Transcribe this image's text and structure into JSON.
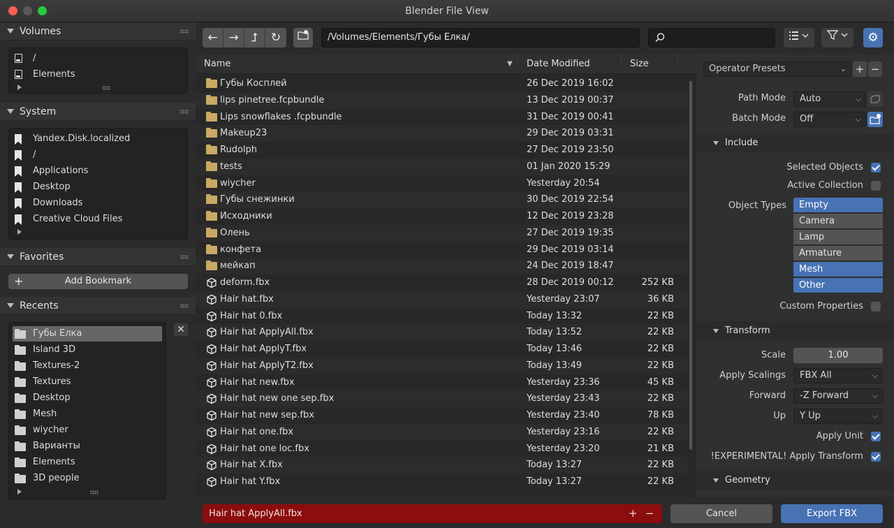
{
  "window": {
    "title": "Blender File View"
  },
  "sidebar": {
    "volumes": {
      "title": "Volumes",
      "items": [
        {
          "label": "/"
        },
        {
          "label": "Elements"
        }
      ]
    },
    "system": {
      "title": "System",
      "items": [
        {
          "label": "Yandex.Disk.localized"
        },
        {
          "label": "/"
        },
        {
          "label": "Applications"
        },
        {
          "label": "Desktop"
        },
        {
          "label": "Downloads"
        },
        {
          "label": "Creative Cloud Files"
        }
      ]
    },
    "favorites": {
      "title": "Favorites",
      "add_label": "Add Bookmark"
    },
    "recents": {
      "title": "Recents",
      "items": [
        {
          "label": "Губы Елка"
        },
        {
          "label": "Island 3D"
        },
        {
          "label": "Textures-2"
        },
        {
          "label": "Textures"
        },
        {
          "label": "Desktop"
        },
        {
          "label": "Mesh"
        },
        {
          "label": "wiycher"
        },
        {
          "label": "Варианты"
        },
        {
          "label": "Elements"
        },
        {
          "label": "3D people"
        }
      ]
    }
  },
  "toolbar": {
    "path": "/Volumes/Elements/Губы Елка/"
  },
  "file_list": {
    "columns": {
      "name": "Name",
      "date": "Date Modified",
      "size": "Size"
    },
    "rows": [
      {
        "name": " Губы Косплей",
        "date": "26 Dec 2019 16:02",
        "size": "",
        "type": "folder"
      },
      {
        "name": "lips pinetree.fcpbundle",
        "date": "13 Dec 2019 00:37",
        "size": "",
        "type": "folder"
      },
      {
        "name": "Lips snowflakes .fcpbundle",
        "date": "31 Dec 2019 00:41",
        "size": "",
        "type": "folder"
      },
      {
        "name": "Makeup23",
        "date": "29 Dec 2019 03:31",
        "size": "",
        "type": "folder"
      },
      {
        "name": "Rudolph",
        "date": "27 Dec 2019 23:50",
        "size": "",
        "type": "folder"
      },
      {
        "name": "tests",
        "date": "01 Jan 2020 15:29",
        "size": "",
        "type": "folder"
      },
      {
        "name": "wiycher",
        "date": "Yesterday 20:54",
        "size": "",
        "type": "folder"
      },
      {
        "name": "Губы снежинки",
        "date": "30 Dec 2019 22:54",
        "size": "",
        "type": "folder"
      },
      {
        "name": "Исходники",
        "date": "12 Dec 2019 23:28",
        "size": "",
        "type": "folder"
      },
      {
        "name": "Олень",
        "date": "27 Dec 2019 19:35",
        "size": "",
        "type": "folder"
      },
      {
        "name": "конфета",
        "date": "29 Dec 2019 03:14",
        "size": "",
        "type": "folder"
      },
      {
        "name": "мейкап",
        "date": "24 Dec 2019 18:47",
        "size": "",
        "type": "folder"
      },
      {
        "name": "deform.fbx",
        "date": "28 Dec 2019 00:12",
        "size": "252 KB",
        "type": "file"
      },
      {
        "name": "Hair hat.fbx",
        "date": "Yesterday 23:07",
        "size": "36 KB",
        "type": "file"
      },
      {
        "name": "Hair hat 0.fbx",
        "date": "Today 13:32",
        "size": "22 KB",
        "type": "file"
      },
      {
        "name": "Hair hat ApplyAll.fbx",
        "date": "Today 13:52",
        "size": "22 KB",
        "type": "file"
      },
      {
        "name": "Hair hat ApplyT.fbx",
        "date": "Today 13:46",
        "size": "22 KB",
        "type": "file"
      },
      {
        "name": "Hair hat ApplyT2.fbx",
        "date": "Today 13:49",
        "size": "22 KB",
        "type": "file"
      },
      {
        "name": "Hair hat new.fbx",
        "date": "Yesterday 23:36",
        "size": "45 KB",
        "type": "file"
      },
      {
        "name": "Hair hat new one sep.fbx",
        "date": "Yesterday 23:43",
        "size": "22 KB",
        "type": "file"
      },
      {
        "name": "Hair hat new sep.fbx",
        "date": "Yesterday 23:40",
        "size": "78 KB",
        "type": "file"
      },
      {
        "name": "Hair hat one.fbx",
        "date": "Yesterday 23:16",
        "size": "22 KB",
        "type": "file"
      },
      {
        "name": "Hair hat one loc.fbx",
        "date": "Yesterday 23:20",
        "size": "21 KB",
        "type": "file"
      },
      {
        "name": "Hair hat X.fbx",
        "date": "Today 13:27",
        "size": "22 KB",
        "type": "file"
      },
      {
        "name": "Hair hat Y.fbx",
        "date": "Today 13:27",
        "size": "22 KB",
        "type": "file"
      }
    ]
  },
  "bottom": {
    "filename": "Hair hat ApplyAll.fbx",
    "cancel_label": "Cancel",
    "export_label": "Export FBX"
  },
  "settings": {
    "presets_label": "Operator Presets",
    "path_mode": {
      "label": "Path Mode",
      "value": "Auto"
    },
    "batch_mode": {
      "label": "Batch Mode",
      "value": "Off"
    },
    "include": {
      "title": "Include",
      "selected_objects": {
        "label": "Selected Objects",
        "checked": true
      },
      "active_collection": {
        "label": "Active Collection",
        "checked": false
      },
      "object_types_label": "Object Types",
      "object_types": [
        {
          "label": "Empty",
          "on": true
        },
        {
          "label": "Camera",
          "on": false
        },
        {
          "label": "Lamp",
          "on": false
        },
        {
          "label": "Armature",
          "on": false
        },
        {
          "label": "Mesh",
          "on": true
        },
        {
          "label": "Other",
          "on": true
        }
      ],
      "custom_properties": {
        "label": "Custom Properties",
        "checked": false
      }
    },
    "transform": {
      "title": "Transform",
      "scale": {
        "label": "Scale",
        "value": "1.00"
      },
      "apply_scalings": {
        "label": "Apply Scalings",
        "value": "FBX All"
      },
      "forward": {
        "label": "Forward",
        "value": "-Z Forward"
      },
      "up": {
        "label": "Up",
        "value": "Y Up"
      },
      "apply_unit": {
        "label": "Apply Unit",
        "checked": true
      },
      "experimental": {
        "label": "!EXPERIMENTAL! Apply Transform",
        "checked": true
      }
    },
    "geometry": {
      "title": "Geometry"
    }
  },
  "colors": {
    "accent": "#4772b3",
    "filename_error": "#8b0d0d",
    "folder": "#c9a964"
  }
}
